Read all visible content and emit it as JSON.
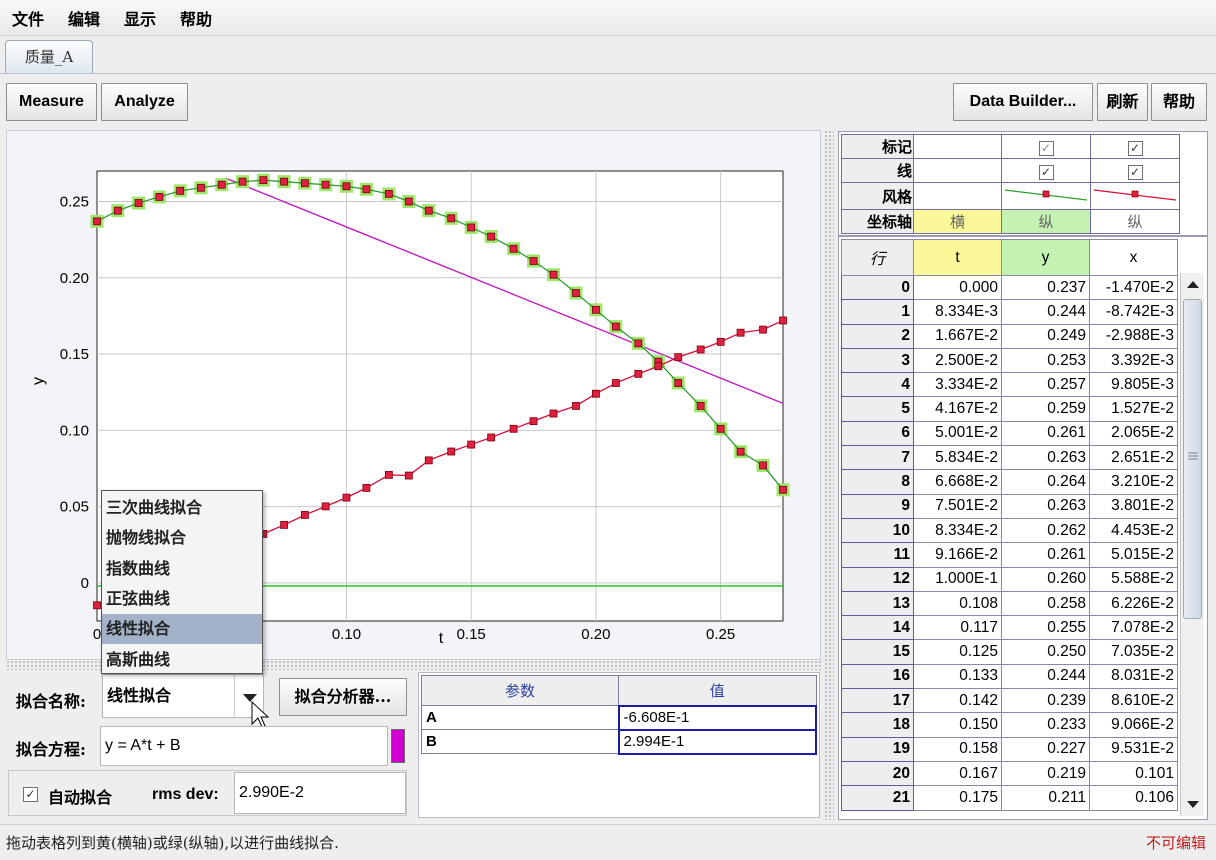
{
  "menu": [
    "文件",
    "编辑",
    "显示",
    "帮助"
  ],
  "tab": {
    "label": "质量_A"
  },
  "toolbar": {
    "measure": "Measure",
    "analyze": "Analyze",
    "data_builder": "Data Builder...",
    "refresh": "刷新",
    "help": "帮助"
  },
  "chart_data": {
    "type": "scatter",
    "xlabel": "t",
    "ylabel": "y",
    "xlim": [
      0,
      0.275
    ],
    "ylim": [
      -0.025,
      0.27
    ],
    "xticks": [
      {
        "v": 0.1,
        "label": "0.10"
      },
      {
        "v": 0.15,
        "label": "0.15"
      },
      {
        "v": 0.2,
        "label": "0.20"
      },
      {
        "v": 0.25,
        "label": "0.25"
      }
    ],
    "xtick_zero": "0",
    "yticks": [
      {
        "v": 0,
        "label": "0"
      },
      {
        "v": 0.05,
        "label": "0.05"
      },
      {
        "v": 0.1,
        "label": "0.10"
      },
      {
        "v": 0.15,
        "label": "0.15"
      },
      {
        "v": 0.2,
        "label": "0.20"
      },
      {
        "v": 0.25,
        "label": "0.25"
      }
    ],
    "grid": true,
    "series": [
      {
        "color": "#2e9e2e",
        "highlight": "#9de86a",
        "marker": "#e02040",
        "x": [
          0,
          0.008334,
          0.01667,
          0.025,
          0.03334,
          0.04167,
          0.05001,
          0.05834,
          0.06668,
          0.07501,
          0.08334,
          0.09166,
          0.1,
          0.108,
          0.117,
          0.125,
          0.133,
          0.142,
          0.15,
          0.158,
          0.167,
          0.175,
          0.183,
          0.192,
          0.2,
          0.208,
          0.217,
          0.225,
          0.233,
          0.242,
          0.25,
          0.258,
          0.267,
          0.275
        ],
        "y": [
          0.237,
          0.244,
          0.249,
          0.253,
          0.257,
          0.259,
          0.261,
          0.263,
          0.264,
          0.263,
          0.262,
          0.261,
          0.26,
          0.258,
          0.255,
          0.25,
          0.244,
          0.239,
          0.233,
          0.227,
          0.219,
          0.211,
          0.202,
          0.19,
          0.179,
          0.168,
          0.157,
          0.145,
          0.131,
          0.116,
          0.101,
          0.086,
          0.077,
          0.061
        ]
      },
      {
        "color": "#d0103a",
        "marker": "#e02040",
        "x": [
          0,
          0.008334,
          0.01667,
          0.025,
          0.03334,
          0.04167,
          0.05001,
          0.05834,
          0.06668,
          0.07501,
          0.08334,
          0.09166,
          0.1,
          0.108,
          0.117,
          0.125,
          0.133,
          0.142,
          0.15,
          0.158,
          0.167,
          0.175,
          0.183,
          0.192,
          0.2,
          0.208,
          0.217,
          0.225,
          0.233,
          0.242,
          0.25,
          0.258,
          0.267,
          0.275
        ],
        "y": [
          -0.0147,
          -0.008742,
          -0.002988,
          0.003392,
          0.009805,
          0.01527,
          0.02065,
          0.02651,
          0.0321,
          0.03801,
          0.04453,
          0.05015,
          0.05588,
          0.06226,
          0.07078,
          0.07035,
          0.08031,
          0.0861,
          0.09066,
          0.09531,
          0.101,
          0.106,
          0.111,
          0.116,
          0.124,
          0.131,
          0.137,
          0.142,
          0.148,
          0.153,
          0.158,
          0.164,
          0.166,
          0.172
        ]
      }
    ],
    "fit_line": {
      "color": "#c020c0",
      "A": -0.6608,
      "B": 0.2994,
      "x_from": 0.0515
    },
    "zero_line": {
      "color": "#33cc33",
      "y": -0.002,
      "x_from": 0.0
    }
  },
  "fit": {
    "name_label": "拟合名称:",
    "name_value": "线性拟合",
    "analyzer_button": "拟合分析器...",
    "equation_label": "拟合方程:",
    "equation_value": "y = A*t + B",
    "auto_fit_label": "自动拟合",
    "auto_fit_checked": true,
    "rms_label": "rms dev:",
    "rms_value": "2.990E-2",
    "swatch_color": "#d000d0",
    "options": [
      "三次曲线拟合",
      "抛物线拟合",
      "指数曲线",
      "正弦曲线",
      "线性拟合",
      "高斯曲线"
    ],
    "selected_index": 4
  },
  "params": {
    "headers": [
      "参数",
      "值"
    ],
    "rows": [
      [
        "A",
        "-6.608E-1"
      ],
      [
        "B",
        "2.994E-1"
      ]
    ]
  },
  "table_header": {
    "row_labels": [
      "标记",
      "线",
      "风格",
      "坐标轴"
    ],
    "axis_roles": [
      "横",
      "纵",
      "纵"
    ],
    "colors": {
      "yellow": "#fbf89a",
      "green": "#c4f2b2"
    }
  },
  "data_table": {
    "row_col": "行",
    "columns": [
      "t",
      "y",
      "x"
    ],
    "rows": [
      [
        "0",
        "0.000",
        "0.237",
        "-1.470E-2"
      ],
      [
        "1",
        "8.334E-3",
        "0.244",
        "-8.742E-3"
      ],
      [
        "2",
        "1.667E-2",
        "0.249",
        "-2.988E-3"
      ],
      [
        "3",
        "2.500E-2",
        "0.253",
        "3.392E-3"
      ],
      [
        "4",
        "3.334E-2",
        "0.257",
        "9.805E-3"
      ],
      [
        "5",
        "4.167E-2",
        "0.259",
        "1.527E-2"
      ],
      [
        "6",
        "5.001E-2",
        "0.261",
        "2.065E-2"
      ],
      [
        "7",
        "5.834E-2",
        "0.263",
        "2.651E-2"
      ],
      [
        "8",
        "6.668E-2",
        "0.264",
        "3.210E-2"
      ],
      [
        "9",
        "7.501E-2",
        "0.263",
        "3.801E-2"
      ],
      [
        "10",
        "8.334E-2",
        "0.262",
        "4.453E-2"
      ],
      [
        "11",
        "9.166E-2",
        "0.261",
        "5.015E-2"
      ],
      [
        "12",
        "1.000E-1",
        "0.260",
        "5.588E-2"
      ],
      [
        "13",
        "0.108",
        "0.258",
        "6.226E-2"
      ],
      [
        "14",
        "0.117",
        "0.255",
        "7.078E-2"
      ],
      [
        "15",
        "0.125",
        "0.250",
        "7.035E-2"
      ],
      [
        "16",
        "0.133",
        "0.244",
        "8.031E-2"
      ],
      [
        "17",
        "0.142",
        "0.239",
        "8.610E-2"
      ],
      [
        "18",
        "0.150",
        "0.233",
        "9.066E-2"
      ],
      [
        "19",
        "0.158",
        "0.227",
        "9.531E-2"
      ],
      [
        "20",
        "0.167",
        "0.219",
        "0.101"
      ],
      [
        "21",
        "0.175",
        "0.211",
        "0.106"
      ]
    ]
  },
  "status": {
    "hint": "拖动表格列到黄(横轴)或绿(纵轴),以进行曲线拟合.",
    "mode": "不可编辑"
  }
}
